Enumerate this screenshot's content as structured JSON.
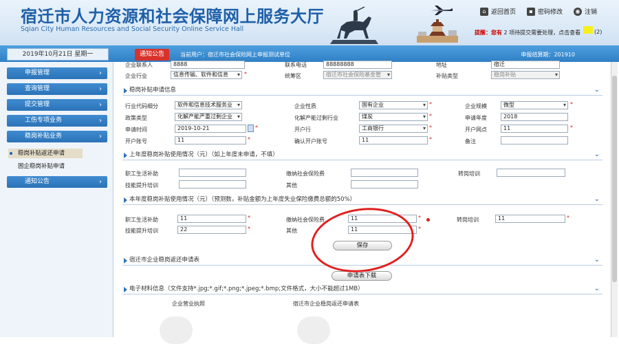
{
  "header": {
    "title": "宿迁市人力资源和社会保障网上服务大厅",
    "subtitle": "Sqian City Human Resources and Social Security Online Service Hall",
    "links": {
      "home": "返回首页",
      "password": "密码修改",
      "logout": "注销"
    },
    "notice": {
      "prefix": "提醒：您有",
      "count": "2",
      "suffix": "项待提交需要处理，点击查看",
      "badge": "(2)"
    }
  },
  "topbar": {
    "date": "2019年10月21日 星期一",
    "notice_tab": "通知公告",
    "current_user": "当前用户：宿迁市社会保险网上申报测试单位",
    "settlement": "申报结算期：201910"
  },
  "sidebar": {
    "menus": [
      "申报管理",
      "查询管理",
      "提交管理",
      "工伤专项业务",
      "稳岗补贴业务",
      "通知公告"
    ],
    "submenus": [
      "稳岗补贴返还申请",
      "困企稳岗补贴申请"
    ]
  },
  "top_row": {
    "contact_label": "企业联系人",
    "contact_value": "8888",
    "phone_label": "联系电话",
    "phone_value": "88888888",
    "address_label": "地址",
    "address_value": "宿迁",
    "industry_label": "企业行业",
    "industry_value": "信息传输、软件和信息",
    "area_label": "统筹区",
    "area_value": "宿迁市社会保险基金管",
    "subsidy_type_label": "补贴类型",
    "subsidy_type_value": "稳岗补贴"
  },
  "apply_section": {
    "title": "稳岗补贴申请信息",
    "fields": {
      "code_label": "行业代码细分",
      "code_value": "软件和信息技术服务业",
      "nature_label": "企业性质",
      "nature_value": "国有企业",
      "scale_label": "企业规模",
      "scale_value": "微型",
      "policy_label": "政策类型",
      "policy_value": "化解产能严重过剩企业",
      "capacity_label": "化解产能过剩行业",
      "capacity_value": "煤炭",
      "year_label": "申请年度",
      "year_value": "2018",
      "time_label": "申请时间",
      "time_value": "2019-10-21",
      "bank_label": "开户行",
      "bank_value": "工商银行",
      "branch_label": "开户网点",
      "branch_value": "11",
      "account_label": "开户账号",
      "account_value": "11",
      "confirm_label": "确认开户账号",
      "confirm_value": "11",
      "remark_label": "备注",
      "remark_value": ""
    }
  },
  "last_year_section": {
    "title": "上年度稳岗补贴使用情况（元）（如上年度未申请，不填）",
    "fields": {
      "wage_label": "职工生活补助",
      "insurance_label": "缴纳社会保险费",
      "training_label": "转岗培训",
      "skill_label": "技能提升培训",
      "other_label": "其他"
    }
  },
  "this_year_section": {
    "title": "本年度稳岗补贴使用情况（元）（预测数，补贴金额为上年度失业保险缴费总额的50%）",
    "fields": {
      "wage_label": "职工生活补助",
      "wage_value": "11",
      "insurance_label": "缴纳社会保险费",
      "insurance_value": "11",
      "training_label": "转岗培训",
      "training_value": "11",
      "skill_label": "技能提升培训",
      "skill_value": "22",
      "other_label": "其他",
      "other_value": "11"
    },
    "save_button": "保存"
  },
  "form_section": {
    "title": "宿迁市企业稳岗返还申请表",
    "download_button": "申请表下载"
  },
  "materials_section": {
    "title": "电子材料信息（文件支持*.jpg;*.gif;*.png;*.jpeg;*.bmp;文件格式，大小不能超过1MB）",
    "license_label": "企业营业执照",
    "form_label": "宿迁市企业稳岗返还申请表"
  },
  "colors": {
    "accent": "#2c73b8",
    "annotation": "#e02020",
    "notice_tab": "#d8322c"
  }
}
